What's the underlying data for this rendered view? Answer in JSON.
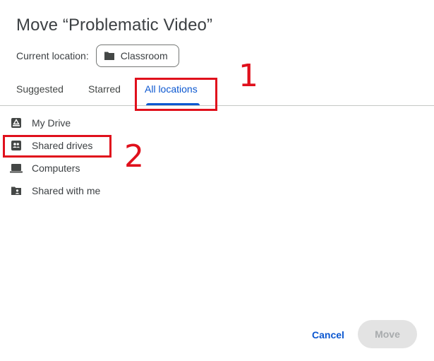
{
  "dialog": {
    "title": "Move “Problematic Video”",
    "current_location_label": "Current location:",
    "current_location_value": "Classroom"
  },
  "tabs": [
    {
      "label": "Suggested",
      "selected": false
    },
    {
      "label": "Starred",
      "selected": false
    },
    {
      "label": "All locations",
      "selected": true
    }
  ],
  "locations": [
    {
      "label": "My Drive",
      "icon": "my-drive-icon"
    },
    {
      "label": "Shared drives",
      "icon": "shared-drives-icon"
    },
    {
      "label": "Computers",
      "icon": "computer-icon"
    },
    {
      "label": "Shared with me",
      "icon": "shared-with-me-icon"
    }
  ],
  "footer": {
    "cancel_label": "Cancel",
    "move_label": "Move",
    "move_enabled": false
  },
  "annotations": [
    {
      "number": "1",
      "target": "All locations"
    },
    {
      "number": "2",
      "target": "Shared drives"
    }
  ],
  "colors": {
    "accent": "#0b57d0",
    "annotation": "#e0101c",
    "disabled_button": "#e3e3e3"
  }
}
